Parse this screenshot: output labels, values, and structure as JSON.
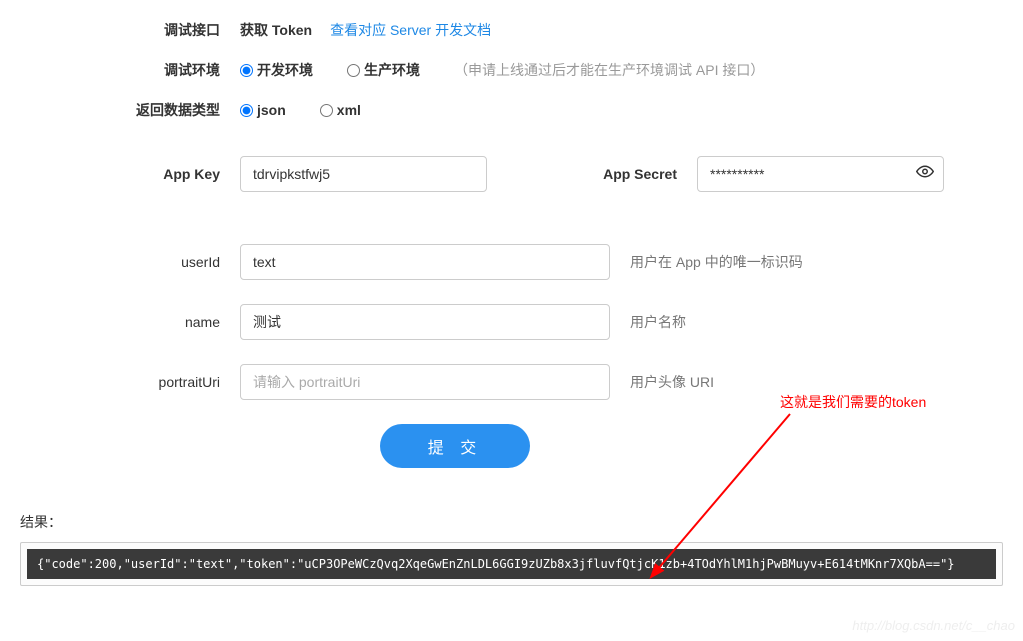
{
  "rows": {
    "api": {
      "label": "调试接口",
      "value": "获取 Token",
      "link": "查看对应 Server 开发文档"
    },
    "env": {
      "label": "调试环境",
      "opt_dev": "开发环境",
      "opt_prod": "生产环境",
      "note": "（申请上线通过后才能在生产环境调试 API 接口）"
    },
    "fmt": {
      "label": "返回数据类型",
      "opt_json": "json",
      "opt_xml": "xml"
    }
  },
  "creds": {
    "appkey_label": "App Key",
    "appkey_value": "tdrvipkstfwj5",
    "secret_label": "App Secret",
    "secret_value": "**********"
  },
  "params": {
    "userid": {
      "label": "userId",
      "value": "text",
      "hint": "用户在 App 中的唯一标识码"
    },
    "name": {
      "label": "name",
      "value": "测试",
      "hint": "用户名称"
    },
    "portrait": {
      "label": "portraitUri",
      "placeholder": "请输入 portraitUri",
      "hint": "用户头像 URI"
    }
  },
  "submit": "提 交",
  "result": {
    "label": "结果：",
    "body": "{\"code\":200,\"userId\":\"text\",\"token\":\"uCP3OPeWCzQvq2XqeGwEnZnLDL6GGI9zUZb8x3jfluvfQtjcK1zb+4TOdYhlM1hjPwBMuyv+E614tMKnr7XQbA==\"}"
  },
  "annotation": "这就是我们需要的token",
  "watermark": "http://blog.csdn.net/c__chao"
}
